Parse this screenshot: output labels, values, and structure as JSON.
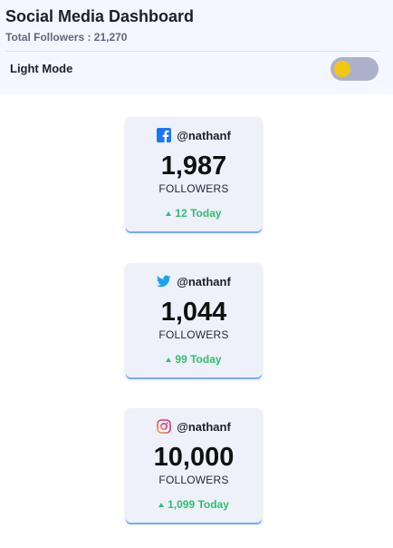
{
  "header": {
    "title": "Social Media Dashboard",
    "total_followers": "Total Followers : 21,270",
    "mode_label": "Light Mode",
    "toggle_on": true
  },
  "colors": {
    "facebook": "#1877f2",
    "twitter": "#1da1f2",
    "instagram": "#e4405f",
    "positive": "#2fbf75",
    "toggle_track": "#aeb1cc",
    "toggle_knob": "#f2c713"
  },
  "cards": [
    {
      "network": "facebook",
      "icon": "facebook-icon",
      "handle": "@nathanf",
      "followers": "1,987",
      "followers_label": "FOLLOWERS",
      "today_icon": "arrow-up-icon",
      "today": "12 Today"
    },
    {
      "network": "twitter",
      "icon": "twitter-icon",
      "handle": "@nathanf",
      "followers": "1,044",
      "followers_label": "FOLLOWERS",
      "today_icon": "arrow-up-icon",
      "today": "99 Today"
    },
    {
      "network": "instagram",
      "icon": "instagram-icon",
      "handle": "@nathanf",
      "followers": "10,000",
      "followers_label": "FOLLOWERS",
      "today_icon": "arrow-up-icon",
      "today": "1,099 Today"
    }
  ]
}
